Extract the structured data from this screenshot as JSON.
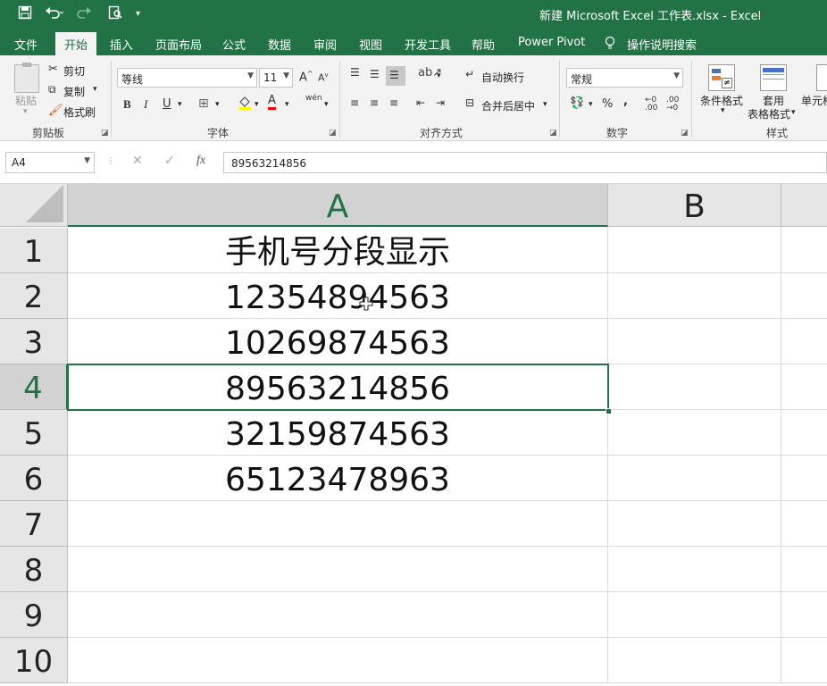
{
  "titlebar": {
    "title": "新建 Microsoft Excel 工作表.xlsx  -  Excel",
    "save_icon": "save-icon",
    "undo_icon": "undo-icon",
    "redo_icon": "redo-icon",
    "print_preview_icon": "print-preview-icon",
    "customize_icon": "customize-qat-icon"
  },
  "tabs": [
    "文件",
    "开始",
    "插入",
    "页面布局",
    "公式",
    "数据",
    "审阅",
    "视图",
    "开发工具",
    "帮助",
    "Power Pivot"
  ],
  "tell_me": "操作说明搜索",
  "ribbon": {
    "clipboard": {
      "paste": "粘贴",
      "cut": "剪切",
      "copy": "复制",
      "format_painter": "格式刷",
      "label": "剪贴板"
    },
    "font": {
      "name": "等线",
      "size": "11",
      "grow": "A",
      "shrink": "A",
      "bold": "B",
      "italic": "I",
      "underline": "U",
      "color_letter": "A",
      "phonetic": "wén",
      "label": "字体"
    },
    "alignment": {
      "wrap_text": "自动换行",
      "merge_center": "合并后居中",
      "label": "对齐方式"
    },
    "number": {
      "format": "常规",
      "percent": "%",
      "comma": ",",
      "label": "数字"
    },
    "styles": {
      "conditional": "条件格式",
      "table_format_1": "套用",
      "table_format_2": "表格格式",
      "cell_styles": "单元格",
      "label": "样式"
    }
  },
  "formula_bar": {
    "name_box": "A4",
    "fx": "fx",
    "value": "89563214856"
  },
  "grid": {
    "columns": [
      "A",
      "B"
    ],
    "rows": [
      "1",
      "2",
      "3",
      "4",
      "5",
      "6",
      "7",
      "8",
      "9",
      "10"
    ],
    "cells_a": [
      "手机号分段显示",
      "12354894563",
      "10269874563",
      "89563214856",
      "32159874563",
      "65123478963",
      "",
      "",
      "",
      ""
    ],
    "selected_row": "4",
    "selected_col": "A"
  },
  "colors": {
    "accent": "#217346"
  }
}
